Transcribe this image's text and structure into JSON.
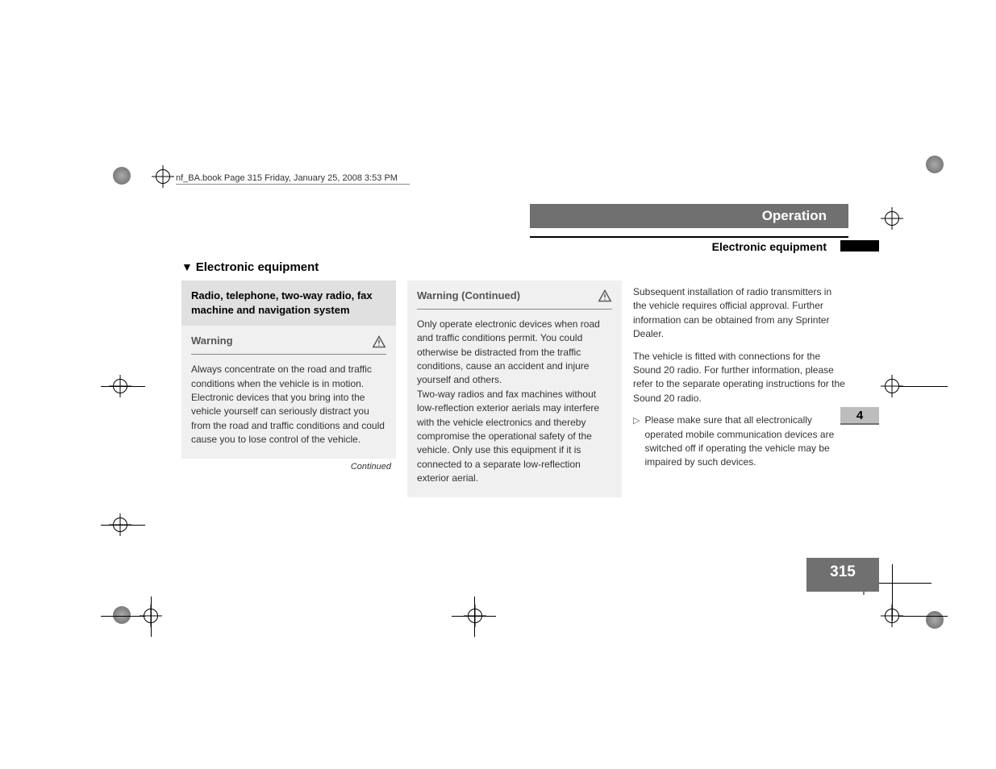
{
  "doc_header": "nf_BA.book  Page 315  Friday, January 25, 2008  3:53 PM",
  "tab_operation": "Operation",
  "tab_subhead": "Electronic equipment",
  "chapter_num": "4",
  "page_num": "315",
  "section_title": "Electronic equipment",
  "graybox_title": "Radio, telephone, two-way radio, fax machine and navigation system",
  "warn1": {
    "title": "Warning",
    "body": "Always concentrate on the road and traffic conditions when the vehicle is in motion. Electronic devices that you bring into the vehicle yourself can seriously distract you from the road and traffic conditions and could cause you to lose control of the vehicle.",
    "continued": "Continued"
  },
  "warn2": {
    "title": "Warning (Continued)",
    "body": "Only operate electronic devices when road and traffic conditions permit. You could otherwise be distracted from the traffic conditions, cause an accident and injure yourself and others.\nTwo-way radios and fax machines without low-reflection exterior aerials may interfere with the vehicle electronics and thereby compromise the operational safety of the vehicle. Only use this equipment if it is connected to a separate low-reflection exterior aerial."
  },
  "col3": {
    "p1": "Subsequent installation of radio transmitters in the vehicle requires official approval. Further information can be obtained from any Sprinter Dealer.",
    "p2": "The vehicle is fitted with connections for the Sound 20 radio. For further information, please refer to the separate operating instructions for the Sound 20 radio.",
    "instr": "Please make sure that all electronically operated mobile communication devices are switched off if operating the vehicle may be impaired by such devices."
  }
}
